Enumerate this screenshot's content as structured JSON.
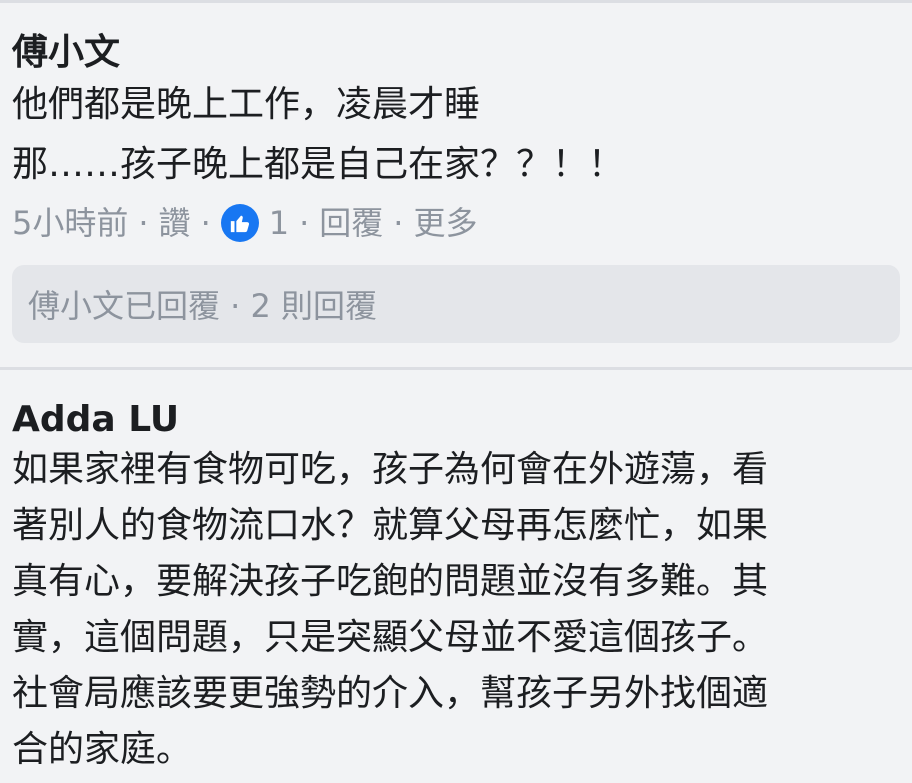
{
  "comments": [
    {
      "author": "傅小文",
      "lines": [
        "他們都是晚上工作，凌晨才睡",
        "那……孩子晚上都是自己在家？？！！"
      ],
      "time": "5小時前",
      "like_label": "讚",
      "reaction_count": "1",
      "reply_label": "回覆",
      "more_label": "更多",
      "replies_summary": "傅小文已回覆 · 2 則回覆",
      "reaction_icon": "thumbs-up-icon",
      "reaction_color": "#1877f2"
    },
    {
      "author": "Adda LU",
      "lines": [
        "如果家裡有食物可吃，孩子為何會在外遊蕩，看",
        "著別人的食物流口水？就算父母再怎麼忙，如果",
        "真有心，要解決孩子吃飽的問題並沒有多難。其",
        "實，這個問題，只是突顯父母並不愛這個孩子。",
        "社會局應該要更強勢的介入，幫孩子另外找個適",
        "合的家庭。"
      ]
    }
  ],
  "separator": "·"
}
